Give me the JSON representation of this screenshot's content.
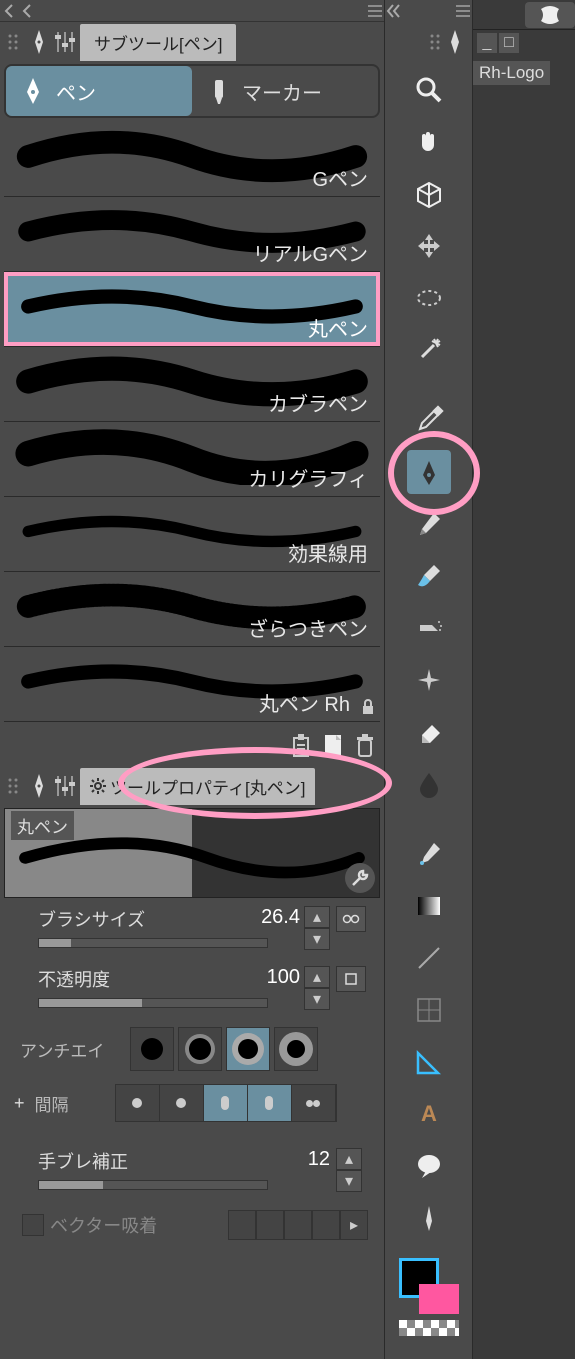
{
  "subtool_panel": {
    "title": "サブツール[ペン]",
    "tabs": [
      {
        "label": "ペン",
        "active": true
      },
      {
        "label": "マーカー",
        "active": false
      }
    ],
    "brushes": [
      {
        "label": "Gペン"
      },
      {
        "label": "リアルGペン"
      },
      {
        "label": "丸ペン",
        "selected": true
      },
      {
        "label": "カブラペン"
      },
      {
        "label": "カリグラフィ"
      },
      {
        "label": "効果線用"
      },
      {
        "label": "ざらつきペン"
      },
      {
        "label": "丸ペン Rh",
        "locked": true
      }
    ]
  },
  "tool_property": {
    "title": "ツールプロパティ[丸ペン]",
    "preview_name": "丸ペン",
    "rows": {
      "brush_size_label": "ブラシサイズ",
      "brush_size_value": "26.4",
      "opacity_label": "不透明度",
      "opacity_value": "100",
      "antialias_label": "アンチエイ",
      "spacing_prefix": "+",
      "spacing_label": "間隔",
      "stabilize_label": "手ブレ補正",
      "stabilize_value": "12",
      "vector_label": "ベクター吸着"
    }
  },
  "toolbar": {
    "tools": [
      "magnifier",
      "hand",
      "cube",
      "move-arrows",
      "ellipse-select",
      "wand",
      "pipette",
      "pen",
      "pencil",
      "brush",
      "airbrush",
      "sparkle",
      "eraser",
      "ink",
      "dip-pen",
      "gradient",
      "line",
      "ruler",
      "triangle-ruler",
      "text",
      "balloon",
      "blade"
    ],
    "selected": "pen"
  },
  "right": {
    "file_tab": "Rh-Logo"
  },
  "colors": {
    "highlight": "#ff9ec4",
    "select": "#6a8fa0"
  }
}
